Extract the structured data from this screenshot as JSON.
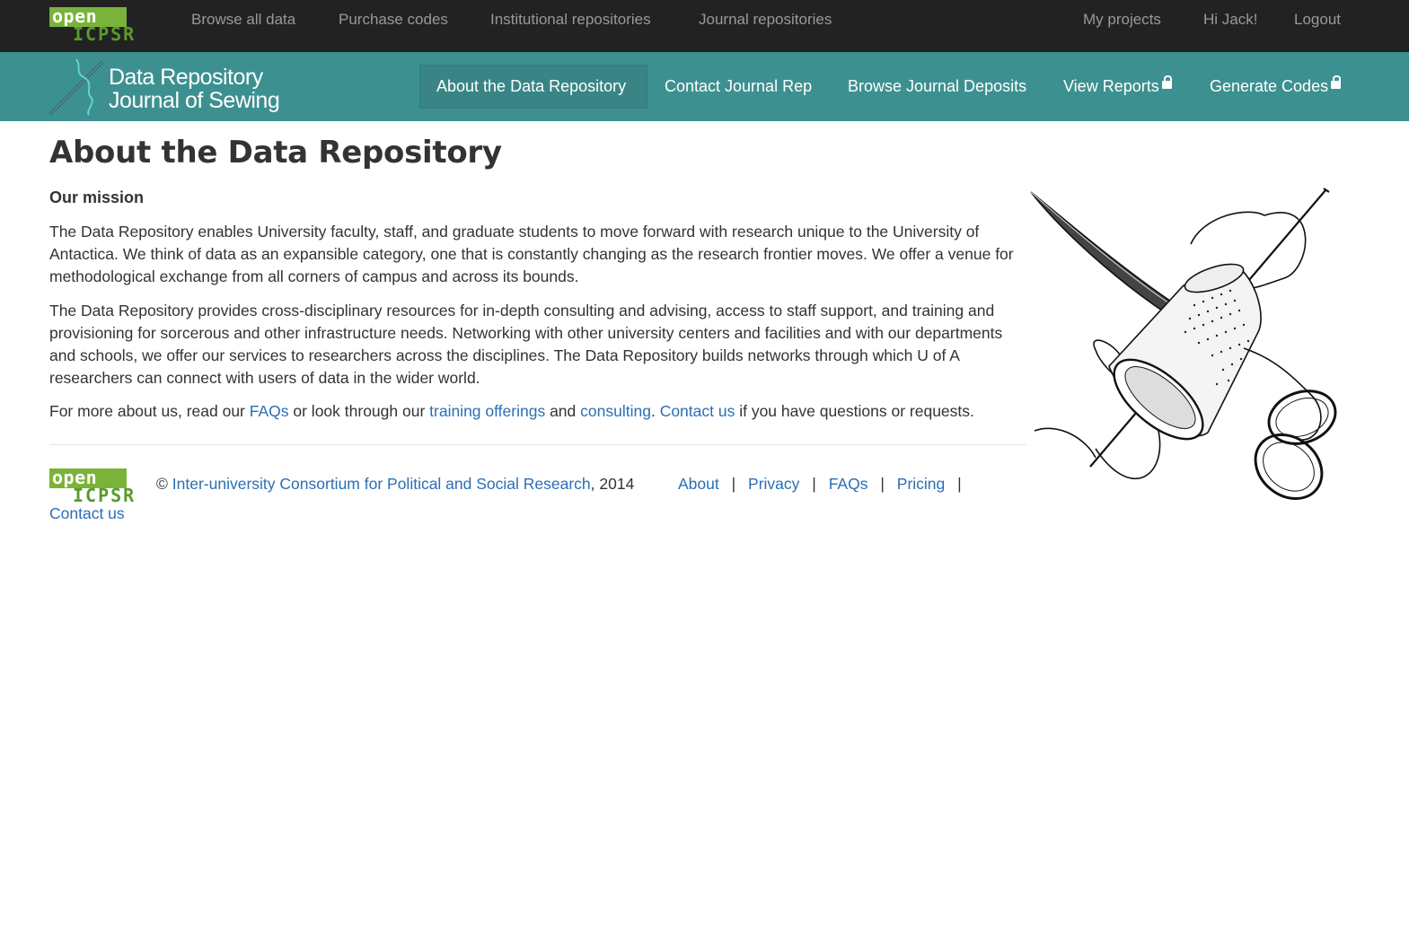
{
  "topbar": {
    "logo_open": "open",
    "logo_icpsr": "ICPSR",
    "nav": [
      "Browse all data",
      "Purchase codes",
      "Institutional repositories",
      "Journal repositories"
    ],
    "right": [
      "My projects",
      "Hi Jack!",
      "Logout"
    ]
  },
  "brand": {
    "line1": "Data Repository",
    "line2": "Journal of Sewing"
  },
  "mainnav": {
    "items": [
      "About the Data Repository",
      "Contact Journal Rep",
      "Browse Journal Deposits",
      "View Reports",
      "Generate Codes"
    ],
    "active": "About the Data Repository"
  },
  "page": {
    "title": "About the Data Repository",
    "mission_heading": "Our mission",
    "p1": "The Data Repository enables University faculty, staff, and graduate students to move forward with research unique to the University of Antactica. We think of data as an expansible category, one that is constantly changing as the research frontier moves. We offer a venue for methodological exchange from all corners of campus and across its bounds.",
    "p2": "The Data Repository provides cross-disciplinary resources for in-depth consulting and advising, access to staff support, and training and provisioning for sorcerous and other infrastructure needs. Networking with other university centers and facilities and with our departments and schools, we offer our services to researchers across the disciplines. The Data Repository builds networks through which U of A researchers can connect with users of data in the wider world.",
    "p3": {
      "t1": "For more about us, read our ",
      "faqs": "FAQs",
      "t2": " or look through our ",
      "training": "training offerings",
      "t3": " and ",
      "consulting": "consulting",
      "t4": ". ",
      "contact": "Contact us",
      "t5": " if you have questions or requests."
    }
  },
  "footer": {
    "copyright": "©",
    "org": "Inter-university Consortium for Political and Social Research",
    "year": ", 2014",
    "links": [
      "About",
      "Privacy",
      "FAQs",
      "Pricing"
    ],
    "separator": "|",
    "contact": "Contact us"
  },
  "colors": {
    "topbar": "#222222",
    "teal": "#3d9090",
    "link": "#2a6fb5",
    "logo_green": "#7ab339"
  }
}
